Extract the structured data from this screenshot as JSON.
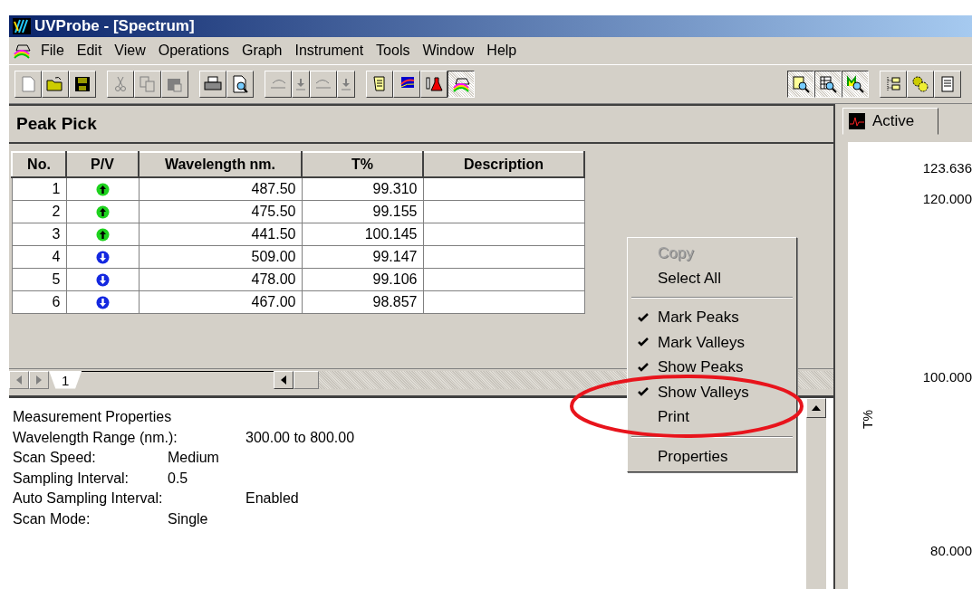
{
  "window": {
    "title": "UVProbe - [Spectrum]"
  },
  "menu": [
    "File",
    "Edit",
    "View",
    "Operations",
    "Graph",
    "Instrument",
    "Tools",
    "Window",
    "Help"
  ],
  "toolbar": {
    "left": [
      [
        {
          "kind": "new",
          "pressed": false
        },
        {
          "kind": "open",
          "pressed": false
        },
        {
          "kind": "save",
          "pressed": false
        }
      ],
      [
        {
          "kind": "cut",
          "pressed": false
        },
        {
          "kind": "copy",
          "pressed": false
        },
        {
          "kind": "paste",
          "pressed": false
        }
      ],
      [
        {
          "kind": "print",
          "pressed": false
        },
        {
          "kind": "preview",
          "pressed": false
        }
      ],
      [
        {
          "kind": "undo",
          "pressed": false
        },
        {
          "kind": "drop",
          "pressed": false
        },
        {
          "kind": "redo",
          "pressed": false
        },
        {
          "kind": "drop",
          "pressed": false
        }
      ],
      [
        {
          "kind": "scroll",
          "pressed": false
        },
        {
          "kind": "graph",
          "pressed": false
        },
        {
          "kind": "flask",
          "pressed": false
        },
        {
          "kind": "rainbow",
          "pressed": true
        }
      ]
    ],
    "right": [
      [
        {
          "kind": "zoomgraph",
          "pressed": true
        },
        {
          "kind": "zoomtable",
          "pressed": true
        },
        {
          "kind": "zoomm",
          "pressed": true
        }
      ],
      [
        {
          "kind": "tree",
          "pressed": false
        },
        {
          "kind": "gear",
          "pressed": false
        },
        {
          "kind": "doc",
          "pressed": false
        }
      ]
    ]
  },
  "peak_pick": {
    "title": "Peak Pick",
    "columns": [
      "No.",
      "P/V",
      "Wavelength nm.",
      "T%",
      "Description"
    ],
    "rows": [
      {
        "no": "1",
        "kind": "peak",
        "wavelength": "487.50",
        "t": "99.310"
      },
      {
        "no": "2",
        "kind": "peak",
        "wavelength": "475.50",
        "t": "99.155"
      },
      {
        "no": "3",
        "kind": "peak",
        "wavelength": "441.50",
        "t": "100.145"
      },
      {
        "no": "4",
        "kind": "valley",
        "wavelength": "509.00",
        "t": "99.147"
      },
      {
        "no": "5",
        "kind": "valley",
        "wavelength": "478.00",
        "t": "99.106"
      },
      {
        "no": "6",
        "kind": "valley",
        "wavelength": "467.00",
        "t": "98.857"
      }
    ],
    "sheet_tab": "1"
  },
  "properties": {
    "title": "Measurement Properties",
    "lines": [
      {
        "label": "Wavelength Range (nm.):",
        "value": "300.00 to 800.00",
        "wide": true
      },
      {
        "label": "Scan Speed:",
        "value": "Medium",
        "wide": false
      },
      {
        "label": "Sampling Interval:",
        "value": "0.5",
        "wide": false
      },
      {
        "label": "Auto Sampling Interval:",
        "value": "Enabled",
        "wide": true
      },
      {
        "label": "Scan Mode:",
        "value": "Single",
        "wide": false
      }
    ]
  },
  "context_menu": [
    {
      "kind": "item",
      "label": "Copy",
      "disabled": true,
      "checked": false
    },
    {
      "kind": "item",
      "label": "Select All",
      "disabled": false,
      "checked": false
    },
    {
      "kind": "separator"
    },
    {
      "kind": "item",
      "label": "Mark Peaks",
      "disabled": false,
      "checked": true
    },
    {
      "kind": "item",
      "label": "Mark Valleys",
      "disabled": false,
      "checked": true
    },
    {
      "kind": "item",
      "label": "Show Peaks",
      "disabled": false,
      "checked": true
    },
    {
      "kind": "item",
      "label": "Show Valleys",
      "disabled": false,
      "checked": true
    },
    {
      "kind": "item",
      "label": "Print",
      "disabled": false,
      "checked": false
    },
    {
      "kind": "separator"
    },
    {
      "kind": "item",
      "label": "Properties",
      "disabled": false,
      "checked": false
    }
  ],
  "graph": {
    "tab": "Active",
    "y_label": "T%",
    "ticks": [
      "123.636",
      "120.000",
      "100.000",
      "80.000"
    ]
  }
}
